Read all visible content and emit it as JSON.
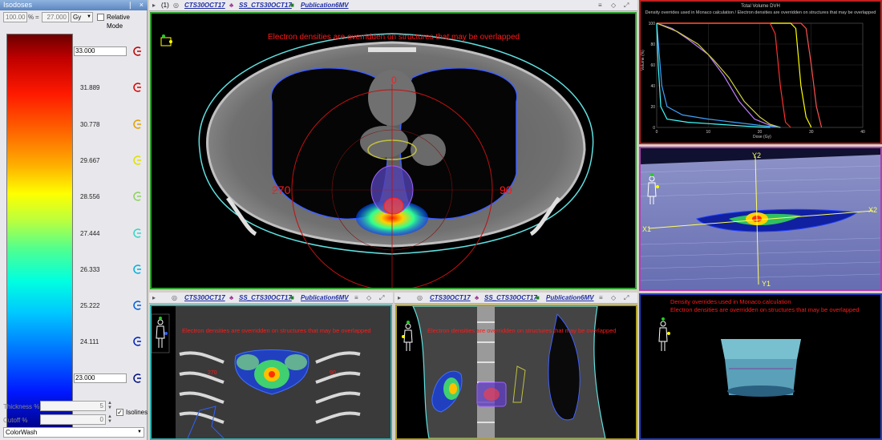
{
  "isodose_panel": {
    "title": "Isodoses",
    "pin_glyph": "❘",
    "close_glyph": "×",
    "percent_value": "100.00",
    "percent_sign": "%",
    "equals": "=",
    "gy_value": "27.000",
    "unit": "Gy",
    "relative_mode_label": "Relative Mode",
    "levels": [
      {
        "value": "33.000",
        "color": "#c00000"
      },
      {
        "value": "31.889",
        "color": "#e00000"
      },
      {
        "value": "30.778",
        "color": "#e0a000"
      },
      {
        "value": "29.667",
        "color": "#e0e000"
      },
      {
        "value": "28.556",
        "color": "#90d060"
      },
      {
        "value": "27.444",
        "color": "#30d8c8"
      },
      {
        "value": "26.333",
        "color": "#00b0e0"
      },
      {
        "value": "25.222",
        "color": "#0060e0"
      },
      {
        "value": "24.111",
        "color": "#0020c0"
      },
      {
        "value": "23.000",
        "color": "#001080"
      }
    ],
    "thickness_label": "Thickness %",
    "thickness_value": "5",
    "cutoff_label": "Cutoff %",
    "cutoff_value": "0",
    "isolines_label": "Isolines",
    "isolines_checked": "✓",
    "colormap_value": "ColorWash"
  },
  "main_view": {
    "toolbar": {
      "index": "(1)",
      "image": "CTS30OCT17",
      "structure_set": "SS_CTS30OCT17",
      "plan": "Publication6MV"
    },
    "overlay_text": "Electron densities are overridden on structures that may be overlapped",
    "angle_0": "0",
    "angle_90": "90",
    "angle_270": "270",
    "border_color": "#2e9e2e"
  },
  "dvh_view": {
    "title": "Total Volume DVH",
    "subtitle": "Density overrides used in Monaco calculation / Electron densities are overridden on structures that may be overlapped",
    "ylabel": "Volume (%)",
    "xlabel": "Dose (Gy)",
    "chart_data": {
      "type": "line",
      "x_ticks": [
        "0",
        "10",
        "20",
        "30",
        "40"
      ],
      "y_ticks": [
        "0",
        "20",
        "40",
        "60",
        "80",
        "100"
      ],
      "xlim": [
        0,
        40
      ],
      "ylim": [
        0,
        100
      ],
      "series": [
        {
          "color": "#ff5050",
          "points": [
            [
              0,
              100
            ],
            [
              28,
              100
            ],
            [
              29,
              95
            ],
            [
              30,
              60
            ],
            [
              31,
              20
            ],
            [
              32,
              0
            ]
          ]
        },
        {
          "color": "#ffff00",
          "points": [
            [
              0,
              100
            ],
            [
              26,
              100
            ],
            [
              27,
              95
            ],
            [
              28,
              40
            ],
            [
              29,
              10
            ],
            [
              30,
              0
            ]
          ]
        },
        {
          "color": "#ff3030",
          "points": [
            [
              0,
              100
            ],
            [
              22,
              100
            ],
            [
              23,
              90
            ],
            [
              24,
              40
            ],
            [
              25,
              5
            ],
            [
              26,
              0
            ]
          ]
        },
        {
          "color": "#c080ff",
          "points": [
            [
              0,
              100
            ],
            [
              3,
              95
            ],
            [
              6,
              85
            ],
            [
              10,
              70
            ],
            [
              13,
              50
            ],
            [
              16,
              25
            ],
            [
              19,
              8
            ],
            [
              22,
              2
            ],
            [
              24,
              0
            ]
          ]
        },
        {
          "color": "#d0d040",
          "points": [
            [
              0,
              100
            ],
            [
              4,
              92
            ],
            [
              8,
              80
            ],
            [
              11,
              65
            ],
            [
              14,
              48
            ],
            [
              17,
              25
            ],
            [
              20,
              10
            ],
            [
              22,
              3
            ],
            [
              24,
              0
            ]
          ]
        },
        {
          "color": "#40a0ff",
          "points": [
            [
              0,
              100
            ],
            [
              0.5,
              70
            ],
            [
              1,
              40
            ],
            [
              2,
              20
            ],
            [
              5,
              12
            ],
            [
              10,
              8
            ],
            [
              15,
              5
            ],
            [
              20,
              2
            ],
            [
              24,
              0
            ]
          ]
        },
        {
          "color": "#40ffff",
          "points": [
            [
              0,
              100
            ],
            [
              0.3,
              60
            ],
            [
              0.8,
              20
            ],
            [
              2,
              8
            ],
            [
              6,
              5
            ],
            [
              12,
              3
            ],
            [
              18,
              1
            ],
            [
              22,
              0
            ]
          ]
        }
      ]
    },
    "border_color": "#c02020"
  },
  "beam_view": {
    "label_y2": "Y2",
    "label_y1": "Y1",
    "label_x1": "X1",
    "label_x2": "X2",
    "border_color": "#b040b0"
  },
  "coronal_view": {
    "toolbar": {
      "image": "CTS30OCT17",
      "structure_set": "SS_CTS30OCT17",
      "plan": "Publication6MV"
    },
    "overlay_text": "Electron densities are overridden on structures that may be overlapped",
    "angle_270": "270",
    "angle_90": "90",
    "border_color": "#30b0b0"
  },
  "sagittal_view": {
    "toolbar": {
      "image": "CTS30OCT17",
      "structure_set": "SS_CTS30OCT17",
      "plan": "Publication6MV"
    },
    "overlay_text": "Electron densities are overridden on structures that may be overlapped",
    "border_color": "#b0a020"
  },
  "render_view": {
    "line1": "Density overrides used in Monaco calculation",
    "line2": "Electron densities are overridden on structures that may be overlapped",
    "border_color": "#2040c0"
  }
}
